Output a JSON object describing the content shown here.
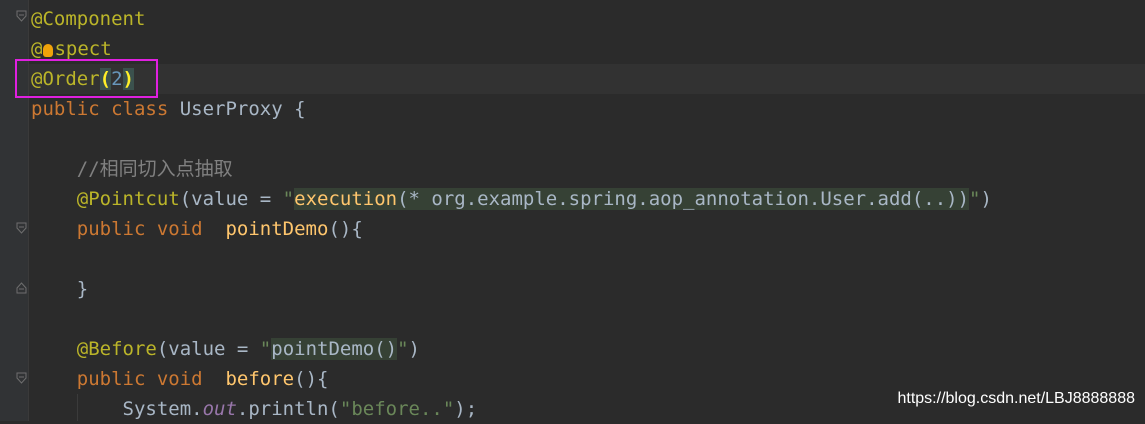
{
  "code": {
    "l1_ann": "@Component",
    "l2_at": "@",
    "l2_rest": "spect",
    "l3_ann": "@Order",
    "l3_open": "(",
    "l3_num": "2",
    "l3_close": ")",
    "l4_kw": "public class ",
    "l4_rest": "UserProxy {",
    "l6_comment": "//相同切入点抽取",
    "l7_ann": "@Pointcut",
    "l7_mid": "(value = ",
    "l7_q1": "\"",
    "l7_fn": "execution",
    "l7_expr": "(* org.example.spring.aop_annotation.User.add(..))",
    "l7_q2": "\"",
    "l7_end": ")",
    "l8_kw": "public void  ",
    "l8_fn": "pointDemo",
    "l8_end": "(){",
    "l10_brace": "}",
    "l12_ann": "@Before",
    "l12_mid": "(value = ",
    "l12_q1": "\"",
    "l12_inj": "pointDemo()",
    "l12_q2": "\"",
    "l12_end": ")",
    "l13_kw": "public void  ",
    "l13_fn": "before",
    "l13_end": "(){",
    "l14_a": "System.",
    "l14_field": "out",
    "l14_b": ".println(",
    "l14_str": "\"before..\"",
    "l14_c": ");"
  },
  "icons": {
    "intention": "lightbulb-icon",
    "fold": "fold-marker-icon"
  },
  "watermark": "https://blog.csdn.net/LBJ8888888"
}
